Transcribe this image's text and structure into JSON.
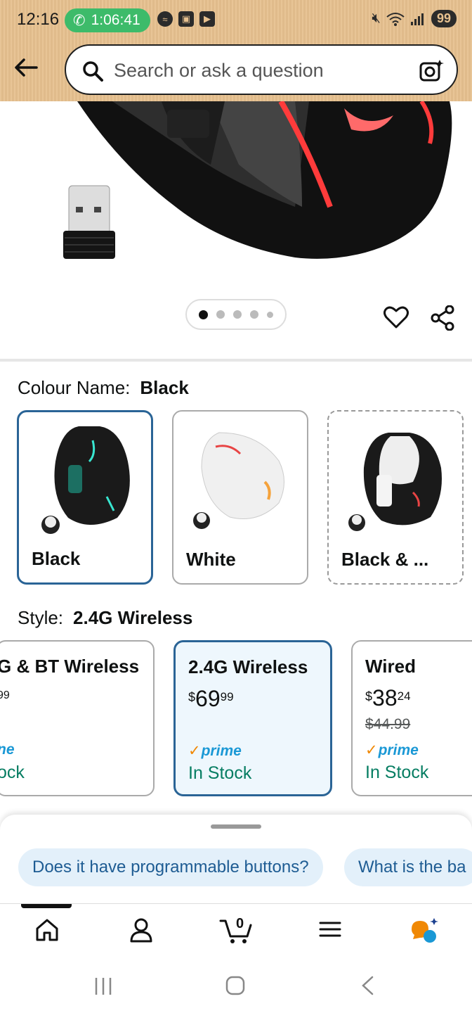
{
  "status_bar": {
    "time": "12:16",
    "call_timer": "1:06:41",
    "battery": "99"
  },
  "header": {
    "search_placeholder": "Search or ask a question",
    "icons": [
      "back-arrow-icon",
      "search-icon",
      "camera-lens-icon"
    ]
  },
  "gallery": {
    "page_count": 5,
    "current_page": 1
  },
  "colour": {
    "label": "Colour Name:",
    "selected": "Black",
    "options": [
      {
        "label": "Black"
      },
      {
        "label": "White"
      },
      {
        "label": "Black & ..."
      }
    ]
  },
  "style": {
    "label": "Style:",
    "selected": "2.4G Wireless",
    "options": [
      {
        "title": "G & BT Wireless",
        "price_frac": "99",
        "prime": "ne",
        "stock": "ock"
      },
      {
        "title": "2.4G Wireless",
        "currency": "$",
        "price_whole": "69",
        "price_frac": "99",
        "prime": "prime",
        "stock": "In Stock"
      },
      {
        "title": "Wired",
        "currency": "$",
        "price_whole": "38",
        "price_frac": "24",
        "was_price": "$44.99",
        "prime": "prime",
        "stock": "In Stock"
      }
    ]
  },
  "suggestions": [
    "Does it have programmable buttons?",
    "What is the ba"
  ],
  "bottom_nav": {
    "cart_count": "0",
    "items": [
      "home-icon",
      "account-icon",
      "cart-icon",
      "menu-icon",
      "rufus-icon"
    ]
  },
  "colors": {
    "header_bg": "#e7c18f",
    "selected_border": "#2a6496",
    "in_stock": "#067d62",
    "prime_blue": "#1a98d5",
    "call_green": "#3dbb6a"
  }
}
